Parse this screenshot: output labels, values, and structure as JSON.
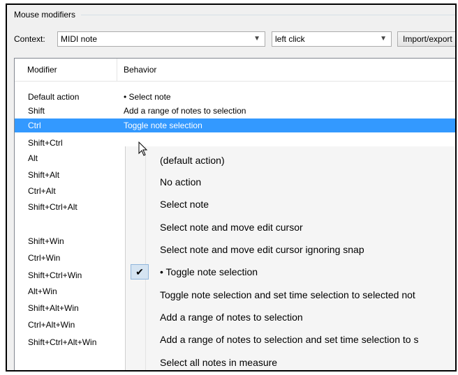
{
  "group": {
    "title": "Mouse modifiers"
  },
  "context": {
    "label": "Context:",
    "selected": "MIDI note",
    "action": "left click",
    "import_export": "Import/export"
  },
  "table": {
    "col_modifier": "Modifier",
    "col_behavior": "Behavior",
    "rows": [
      {
        "modifier": "Default action",
        "behavior": "• Select note"
      },
      {
        "modifier": "Shift",
        "behavior": "Add a range of notes to selection"
      },
      {
        "modifier": "Ctrl",
        "behavior": "Toggle note selection"
      }
    ],
    "more_modifiers": [
      "Shift+Ctrl",
      "Alt",
      "Shift+Alt",
      "Ctrl+Alt",
      "Shift+Ctrl+Alt",
      "Shift+Win",
      "Ctrl+Win",
      "Shift+Ctrl+Win",
      "Alt+Win",
      "Shift+Alt+Win",
      "Ctrl+Alt+Win",
      "Shift+Ctrl+Alt+Win"
    ]
  },
  "menu": {
    "items": [
      "(default action)",
      "No action",
      "Select note",
      "Select note and move edit cursor",
      "Select note and move edit cursor ignoring snap",
      "• Toggle note selection",
      "Toggle note selection and set time selection to selected not",
      "Add a range of notes to selection",
      "Add a range of notes to selection and set time selection to s",
      "Select all notes in measure"
    ],
    "checked_index": 5,
    "check_glyph": "✔"
  },
  "colors": {
    "selection": "#3399ff",
    "menu_check_bg": "#d5e4f2"
  }
}
